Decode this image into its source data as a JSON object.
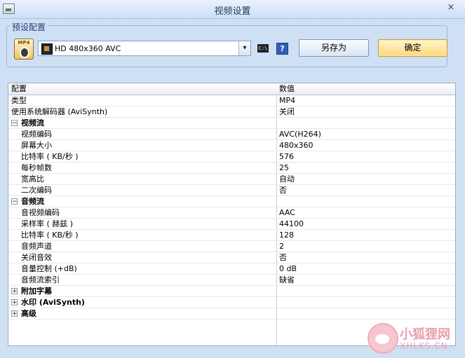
{
  "window": {
    "title": "视频设置",
    "close_symbol": "×"
  },
  "preset": {
    "group_label": "预设配置",
    "icon_text": "MP4",
    "selected": "HD 480x360 AVC",
    "dropdown_arrow": "▾",
    "cmd_icon_text": "C:\\",
    "help_text": "?",
    "save_as_label": "另存为",
    "ok_label": "确定"
  },
  "grid": {
    "header": {
      "name": "配置",
      "value": "数值"
    },
    "rows": [
      {
        "kind": "item",
        "name": "类型",
        "value": "MP4",
        "indent": false
      },
      {
        "kind": "item",
        "name": "使用系统解码器 (AviSynth)",
        "value": "关闭",
        "indent": false
      },
      {
        "kind": "category",
        "name": "视频流",
        "toggle": "−"
      },
      {
        "kind": "item",
        "name": "视频编码",
        "value": "AVC(H264)",
        "indent": true
      },
      {
        "kind": "item",
        "name": "屏幕大小",
        "value": "480x360",
        "indent": true
      },
      {
        "kind": "item",
        "name": "比特率 ( KB/秒 )",
        "value": "576",
        "indent": true
      },
      {
        "kind": "item",
        "name": "每秒帧数",
        "value": "25",
        "indent": true
      },
      {
        "kind": "item",
        "name": "宽高比",
        "value": "自动",
        "indent": true
      },
      {
        "kind": "item",
        "name": "二次编码",
        "value": "否",
        "indent": true
      },
      {
        "kind": "category",
        "name": "音频流",
        "toggle": "−"
      },
      {
        "kind": "item",
        "name": "音视频编码",
        "value": "AAC",
        "indent": true
      },
      {
        "kind": "item",
        "name": "采样率 ( 赫兹 )",
        "value": "44100",
        "indent": true
      },
      {
        "kind": "item",
        "name": "比特率 ( KB/秒 )",
        "value": "128",
        "indent": true
      },
      {
        "kind": "item",
        "name": "音频声道",
        "value": "2",
        "indent": true
      },
      {
        "kind": "item",
        "name": "关闭音效",
        "value": "否",
        "indent": true
      },
      {
        "kind": "item",
        "name": "音量控制 (+dB)",
        "value": "0 dB",
        "indent": true
      },
      {
        "kind": "item",
        "name": "音频流索引",
        "value": "缺省",
        "indent": true
      },
      {
        "kind": "category",
        "name": "附加字幕",
        "toggle": "+"
      },
      {
        "kind": "category",
        "name": "水印 (AviSynth)",
        "toggle": "+"
      },
      {
        "kind": "category",
        "name": "高级",
        "toggle": "+"
      }
    ]
  },
  "watermark": {
    "text": "小狐狸网",
    "sub": "XHLKS.CN"
  }
}
